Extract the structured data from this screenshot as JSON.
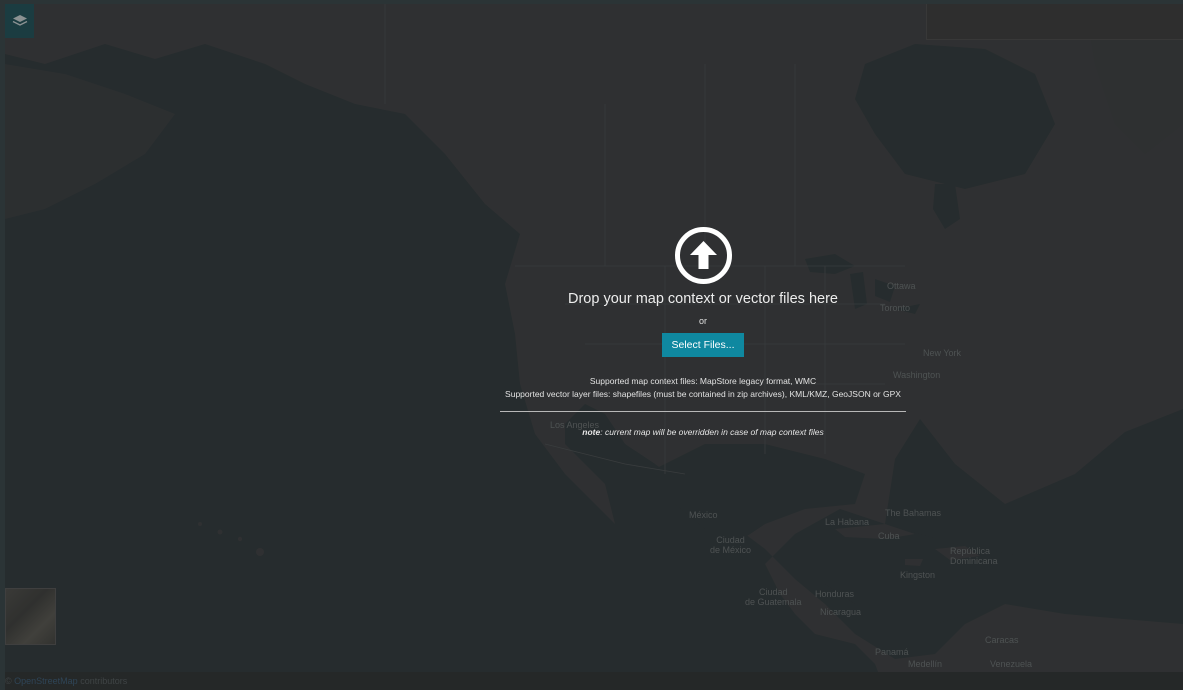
{
  "map": {
    "labels": {
      "ottawa": "Ottawa",
      "toronto": "Toronto",
      "new_york": "New York",
      "washington": "Washington",
      "los_angeles": "Los Angeles",
      "mexico": "México",
      "ciudad_de_mexico": "Ciudad\nde México",
      "la_habana": "La Habana",
      "the_bahamas": "The Bahamas",
      "cuba": "Cuba",
      "republica_dominicana": "República\nDominicana",
      "kingston": "Kingston",
      "ciudad_de_guatemala": "Ciudad\nde Guatemala",
      "honduras": "Honduras",
      "nicaragua": "Nicaragua",
      "panama": "Panamá",
      "medellin": "Medellín",
      "caracas": "Caracas",
      "venezuela": "Venezuela"
    }
  },
  "drop_zone": {
    "title": "Drop your map context or vector files here",
    "or": "or",
    "select_button": "Select Files...",
    "supported_context": "Supported map context files: MapStore legacy format, WMC",
    "supported_vector": "Supported vector layer files: shapefiles (must be contained in zip archives), KML/KMZ, GeoJSON or GPX",
    "note_label": "note",
    "note_text": ": current map will be overridden in case of map context files"
  },
  "attribution": {
    "prefix": "©",
    "link": "OpenStreetMap",
    "suffix": " contributors"
  },
  "colors": {
    "water": "#2d3639",
    "land": "#3a3d3f",
    "overlay": "rgba(30,30,30,0.38)",
    "button": "#0f88a0",
    "layers_button": "#1b4f57"
  }
}
